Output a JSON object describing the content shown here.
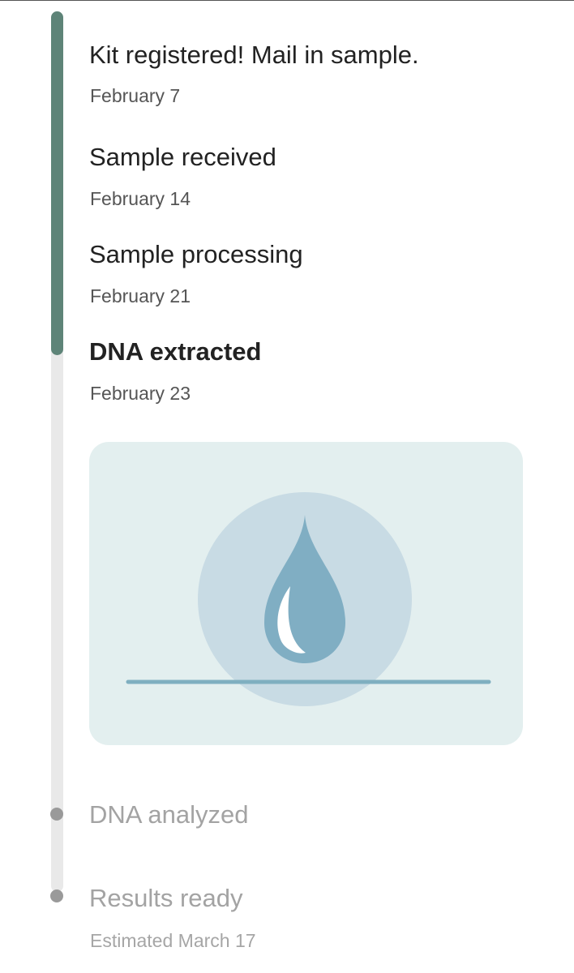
{
  "timeline": {
    "progress_fraction": 0.39,
    "steps": [
      {
        "title": "Kit registered! Mail in sample.",
        "date": "February 7",
        "state": "done"
      },
      {
        "title": "Sample received",
        "date": "February 14",
        "state": "done"
      },
      {
        "title": "Sample processing",
        "date": "February 21",
        "state": "done"
      },
      {
        "title": "DNA extracted",
        "date": "February 23",
        "state": "current"
      },
      {
        "title": "DNA analyzed",
        "date": "",
        "state": "pending"
      },
      {
        "title": "Results ready",
        "date": "Estimated March 17",
        "state": "pending"
      }
    ]
  },
  "illustration": {
    "icon": "water-drop-icon"
  },
  "colors": {
    "progress": "#5e8478",
    "track": "#e9e9e9",
    "card_background": "#e3efef",
    "circle": "#c8dbe4",
    "drop": "#80aec3",
    "line": "#7fafc0",
    "pending_text": "#a3a3a3"
  }
}
